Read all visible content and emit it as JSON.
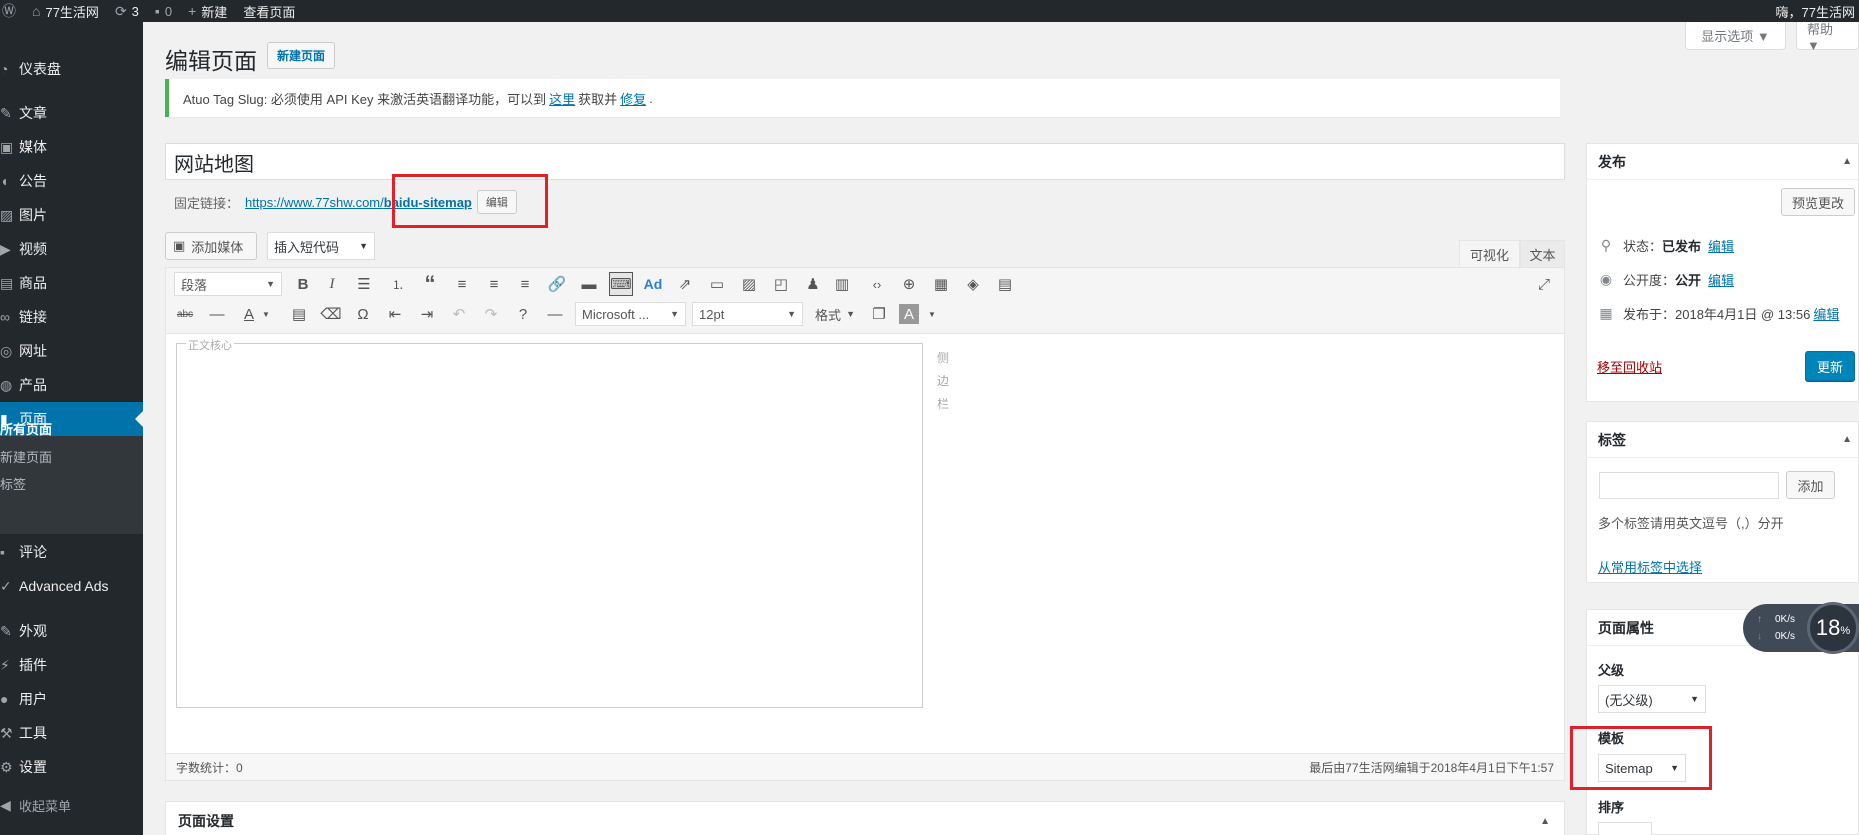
{
  "adminbar": {
    "site_name": "77生活网",
    "updates_count": "3",
    "comments_count": "0",
    "new_label": "新建",
    "view_page_label": "查看页面",
    "greeting": "嗨，77生活网"
  },
  "sidebar": {
    "items": [
      {
        "label": "仪表盘",
        "icon": "dashboard-icon"
      },
      {
        "label": "文章",
        "icon": "pin-icon"
      },
      {
        "label": "媒体",
        "icon": "media-icon"
      },
      {
        "label": "公告",
        "icon": "megaphone-icon"
      },
      {
        "label": "图片",
        "icon": "images-icon"
      },
      {
        "label": "视频",
        "icon": "video-icon"
      },
      {
        "label": "商品",
        "icon": "cart-icon"
      },
      {
        "label": "链接",
        "icon": "link-icon"
      },
      {
        "label": "网址",
        "icon": "globe-icon"
      },
      {
        "label": "产品",
        "icon": "product-icon"
      },
      {
        "label": "页面",
        "icon": "page-icon"
      },
      {
        "label": "评论",
        "icon": "comment-icon"
      },
      {
        "label": "Advanced Ads",
        "icon": "ads-icon"
      },
      {
        "label": "外观",
        "icon": "appearance-icon"
      },
      {
        "label": "插件",
        "icon": "plugin-icon"
      },
      {
        "label": "用户",
        "icon": "users-icon"
      },
      {
        "label": "工具",
        "icon": "tools-icon"
      },
      {
        "label": "设置",
        "icon": "settings-icon"
      }
    ],
    "submenu": [
      "所有页面",
      "新建页面",
      "标签"
    ],
    "collapse_label": "收起菜单"
  },
  "screen_meta": {
    "options_label": "显示选项 ▼",
    "help_label": "帮助 ▼"
  },
  "page": {
    "title": "编辑页面",
    "add_new_label": "新建页面"
  },
  "notice": {
    "text_before": "Atuo Tag Slug: 必须使用 API Key 来激活英语翻译功能，可以到",
    "link1": "这里",
    "text_mid": "获取并",
    "link2": "修复",
    "text_after": "."
  },
  "post": {
    "title": "网站地图",
    "permalink_label": "固定链接：",
    "permalink_base": "https://www.77shw.com/",
    "permalink_slug": "baidu-sitemap",
    "edit_slug_label": "编辑"
  },
  "editor": {
    "add_media_label": "添加媒体",
    "shortcode_label": "插入短代码",
    "tab_visual": "可视化",
    "tab_text": "文本",
    "format_select": "段落",
    "font_select": "Microsoft ...",
    "size_select": "12pt",
    "formats_select": "格式",
    "content_legend": "正文核心",
    "sidebar_chars": [
      "侧",
      "边",
      "栏"
    ],
    "word_count": "字数统计：0",
    "last_edited": "最后由77生活网编辑于2018年4月1日下午1:57"
  },
  "page_settings": {
    "title": "页面设置"
  },
  "publish": {
    "title": "发布",
    "preview_label": "预览更改",
    "status_label": "状态：",
    "status_value": "已发布",
    "visibility_label": "公开度：",
    "visibility_value": "公开",
    "published_on": "发布于：2018年4月1日 @ 13:56",
    "edit_label": "编辑",
    "trash_label": "移至回收站",
    "update_label": "更新"
  },
  "tags": {
    "title": "标签",
    "add_label": "添加",
    "hint": "多个标签请用英文逗号（,）分开",
    "choose_label": "从常用标签中选择"
  },
  "page_attributes": {
    "title": "页面属性",
    "parent_label": "父级",
    "parent_value": "(无父级)",
    "template_label": "模板",
    "template_value": "Sitemap",
    "order_label": "排序"
  },
  "speed_widget": {
    "up": "0K/s",
    "down": "0K/s",
    "percent": "18",
    "unit": "%"
  }
}
